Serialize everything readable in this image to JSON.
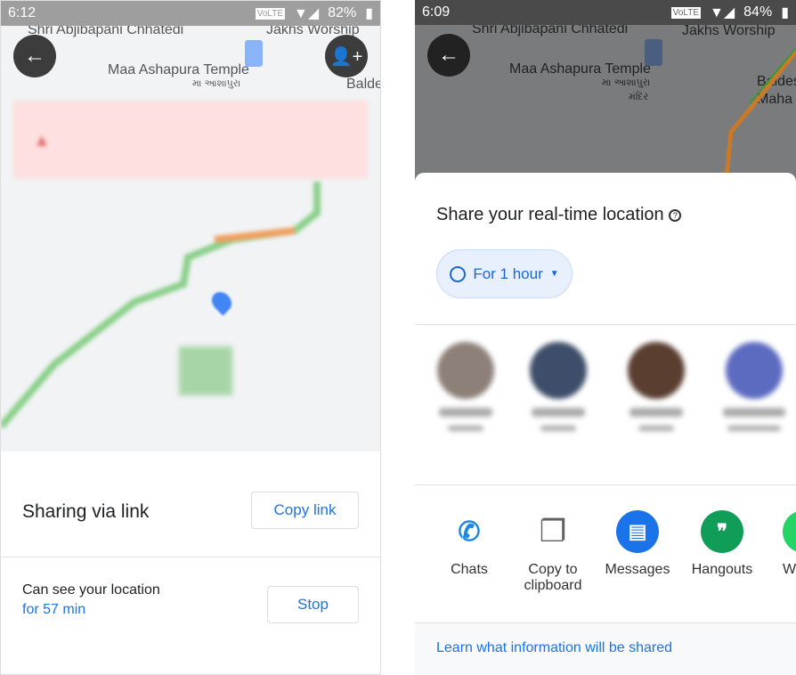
{
  "left": {
    "status": {
      "time": "6:12",
      "battery": "82%",
      "volte": "VoLTE"
    },
    "map_labels": [
      "Shri Abjibapani Chhatedi",
      "Jakhs Worship",
      "Maa Ashapura Temple",
      "મા આશાપુરા",
      "Baldes"
    ],
    "sharing_label": "Sharing via link",
    "copy_link": "Copy link",
    "can_see": "Can see your location",
    "duration": "for 57 min",
    "stop": "Stop"
  },
  "right": {
    "status": {
      "time": "6:09",
      "battery": "84%",
      "volte": "VoLTE"
    },
    "map_labels": [
      "Shri Abjibapani Chhatedi",
      "Jakhs Worship",
      "Maa Ashapura Temple",
      "મા આશાપુરા",
      "મંદિર",
      "Baldes",
      "Maha"
    ],
    "title": "Share your real-time location",
    "duration_chip": "For 1 hour",
    "apps": [
      {
        "label": "Chats",
        "color": "#1e88e5"
      },
      {
        "label": "Copy to clipboard",
        "color": "#616161"
      },
      {
        "label": "Messages",
        "color": "#1a73e8"
      },
      {
        "label": "Hangouts",
        "color": "#0f9d58"
      },
      {
        "label": "W",
        "color": "#25d366"
      }
    ],
    "learn_link": "Learn what information will be shared"
  }
}
